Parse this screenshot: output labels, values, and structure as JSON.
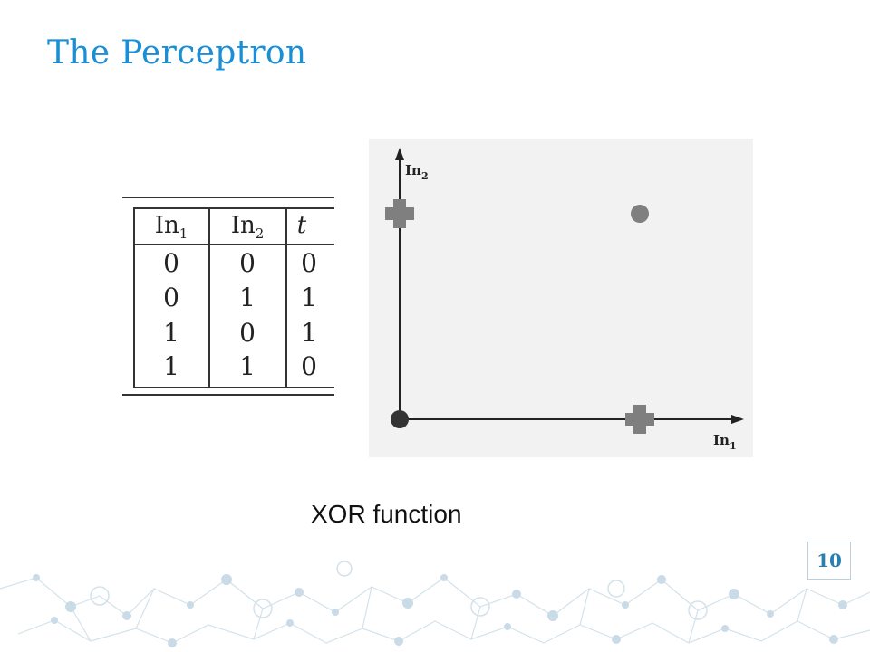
{
  "slide": {
    "title": "The Perceptron",
    "caption": "XOR function",
    "page_number": "10"
  },
  "table": {
    "headers": [
      {
        "base": "In",
        "sub": "1"
      },
      {
        "base": "In",
        "sub": "2"
      },
      {
        "base": "t",
        "sub": ""
      }
    ],
    "rows": [
      [
        "0",
        "0",
        "0"
      ],
      [
        "0",
        "1",
        "1"
      ],
      [
        "1",
        "0",
        "1"
      ],
      [
        "1",
        "1",
        "0"
      ]
    ]
  },
  "plot": {
    "x_axis_label": {
      "base": "In",
      "sub": "1"
    },
    "y_axis_label": {
      "base": "In",
      "sub": "2"
    },
    "points": [
      {
        "x": 0,
        "y": 0,
        "marker": "dot"
      },
      {
        "x": 0,
        "y": 1,
        "marker": "cross"
      },
      {
        "x": 1,
        "y": 0,
        "marker": "cross"
      },
      {
        "x": 1,
        "y": 1,
        "marker": "dot"
      }
    ]
  },
  "colors": {
    "title": "#1a8fd6",
    "marker": "#7f7f7f",
    "decoration": "#c9dbe6"
  }
}
